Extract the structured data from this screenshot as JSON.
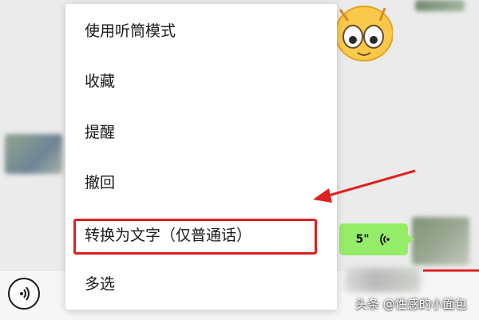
{
  "menu": {
    "items": [
      {
        "label": "使用听筒模式"
      },
      {
        "label": "收藏"
      },
      {
        "label": "提醒"
      },
      {
        "label": "撤回"
      },
      {
        "label": "转换为文字（仅普通话）",
        "highlighted": true
      },
      {
        "label": "多选"
      }
    ]
  },
  "voice_message": {
    "duration": "5\"",
    "bubble_color": "#95ec69"
  },
  "annotation": {
    "color": "#e02020"
  },
  "watermark": {
    "text": "头条 @性感的小面包"
  },
  "icons": {
    "input_toggle": "voice-input-icon",
    "voice_wave": "sound-wave-icon",
    "sticker": "cartoon-cat-sticker"
  }
}
